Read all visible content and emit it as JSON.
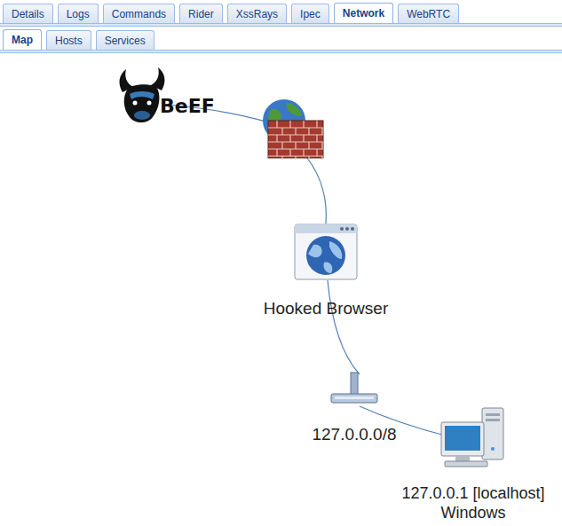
{
  "tabs": [
    {
      "label": "Details",
      "selected": false
    },
    {
      "label": "Logs",
      "selected": false
    },
    {
      "label": "Commands",
      "selected": false
    },
    {
      "label": "Rider",
      "selected": false
    },
    {
      "label": "XssRays",
      "selected": false
    },
    {
      "label": "Ipec",
      "selected": false
    },
    {
      "label": "Network",
      "selected": true
    },
    {
      "label": "WebRTC",
      "selected": false
    }
  ],
  "subtabs": [
    {
      "label": "Map",
      "selected": true
    },
    {
      "label": "Hosts",
      "selected": false
    },
    {
      "label": "Services",
      "selected": false
    }
  ],
  "map": {
    "nodes": [
      {
        "kind": "beef",
        "label": "BeEF"
      },
      {
        "kind": "firewall"
      },
      {
        "kind": "browser",
        "label": "Hooked Browser"
      },
      {
        "kind": "subnet",
        "label": "127.0.0.0/8"
      },
      {
        "kind": "host",
        "label": "127.0.0.1 [localhost]",
        "os": "Windows"
      }
    ]
  }
}
